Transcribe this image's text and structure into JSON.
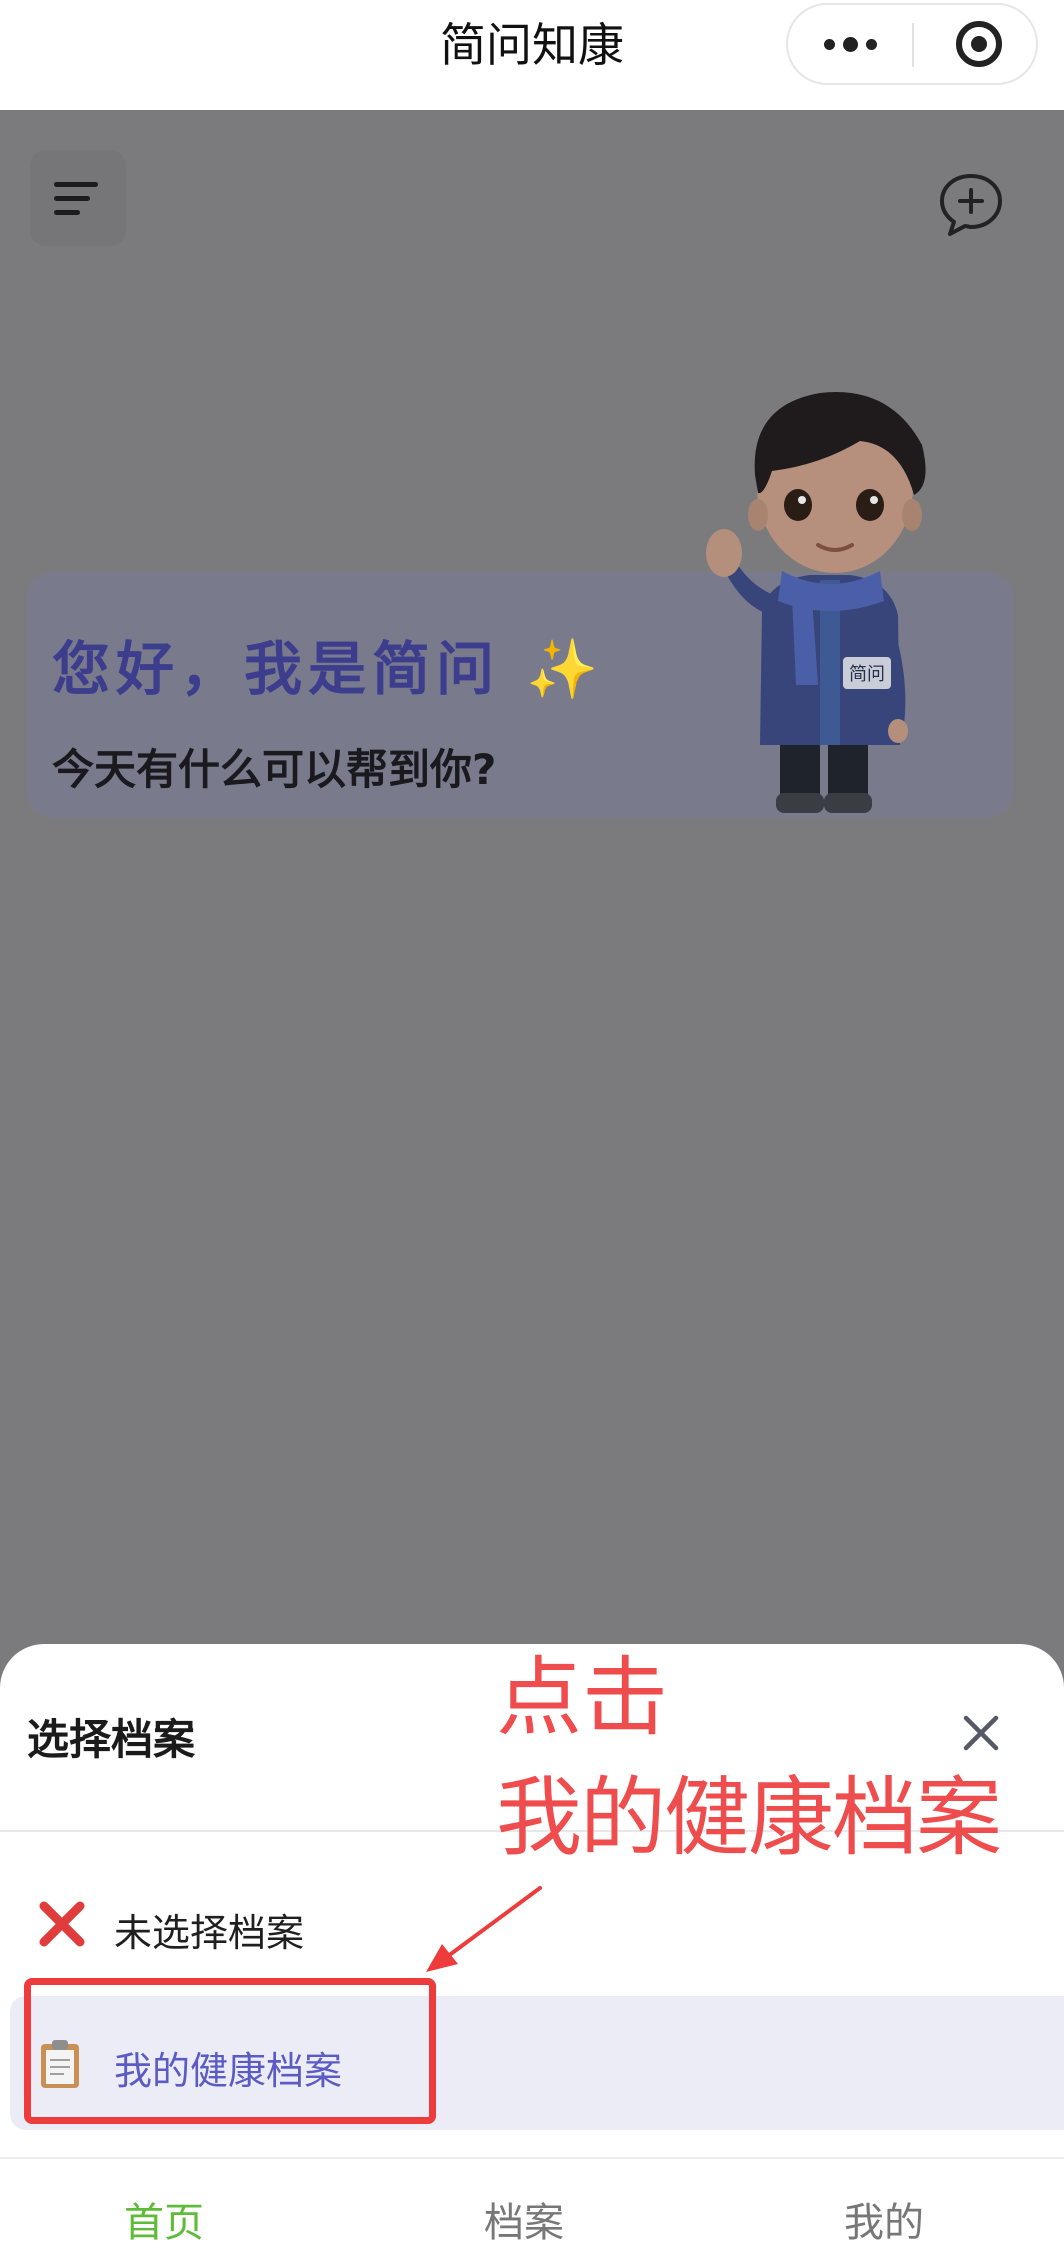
{
  "header": {
    "title": "简问知康",
    "more_icon": "more-dots-icon",
    "close_icon": "target-circle-icon"
  },
  "home": {
    "menu_icon": "menu-lines-icon",
    "new_chat_icon": "chat-plus-icon",
    "greeting_title": "您好，我是简问",
    "greeting_sparkle": "✨",
    "greeting_subtitle": "今天有什么可以帮到你?",
    "mascot_badge": "简问"
  },
  "sheet": {
    "title": "选择档案",
    "close_icon": "close-x-icon",
    "options": [
      {
        "label": "未选择档案",
        "icon": "red-cross-icon",
        "selected": false
      },
      {
        "label": "我的健康档案",
        "icon": "clipboard-icon",
        "selected": true
      }
    ]
  },
  "annotation": {
    "line1": "点击",
    "line2": "我的健康档案",
    "color": "#ef4d4d"
  },
  "tabs": [
    {
      "label": "首页",
      "active": true
    },
    {
      "label": "档案",
      "active": false
    },
    {
      "label": "我的",
      "active": false
    }
  ],
  "colors": {
    "accent": "#5b5bc5",
    "tab_active": "#5fbb3a",
    "overlay": "#7b7b7e"
  }
}
